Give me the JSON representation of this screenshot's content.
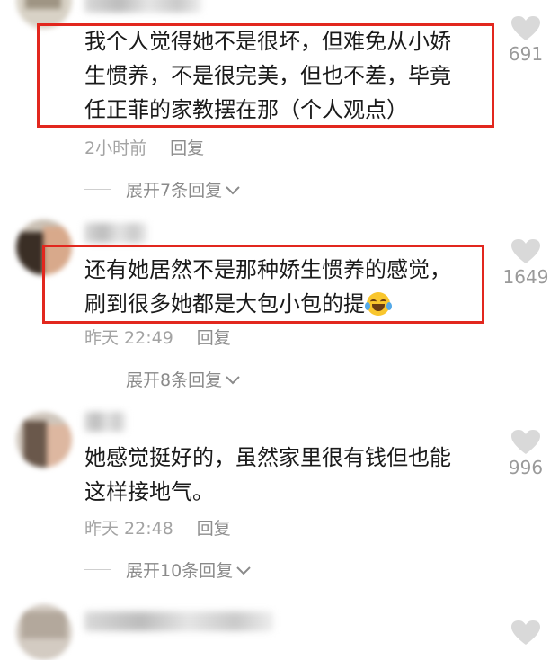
{
  "comments": [
    {
      "lines": [
        "我个人觉得她不是很坏，但难免从小娇",
        "生惯养，不是很完美，但也不差，毕竟",
        "任正菲的家教摆在那（个人观点）"
      ],
      "time": "2小时前",
      "reply": "回复",
      "expand": "展开7条回复",
      "likes": "691",
      "highlighted": true
    },
    {
      "lines": [
        "还有她居然不是那种娇生惯养的感觉，",
        "刷到很多她都是大包小包的提"
      ],
      "emoji": "rofl-emoji",
      "time": "昨天 22:49",
      "reply": "回复",
      "expand": "展开8条回复",
      "likes": "1649",
      "highlighted": true
    },
    {
      "lines": [
        "她感觉挺好的，虽然家里很有钱但也能",
        "这样接地气。"
      ],
      "time": "昨天 22:48",
      "reply": "回复",
      "expand": "展开10条回复",
      "likes": "996",
      "highlighted": false
    }
  ],
  "colors": {
    "highlight": "#e2271e",
    "meta": "#a3a3a3",
    "text": "#1a1a1a"
  },
  "icons": {
    "like": "heart-icon",
    "expand": "chevron-down-icon"
  }
}
